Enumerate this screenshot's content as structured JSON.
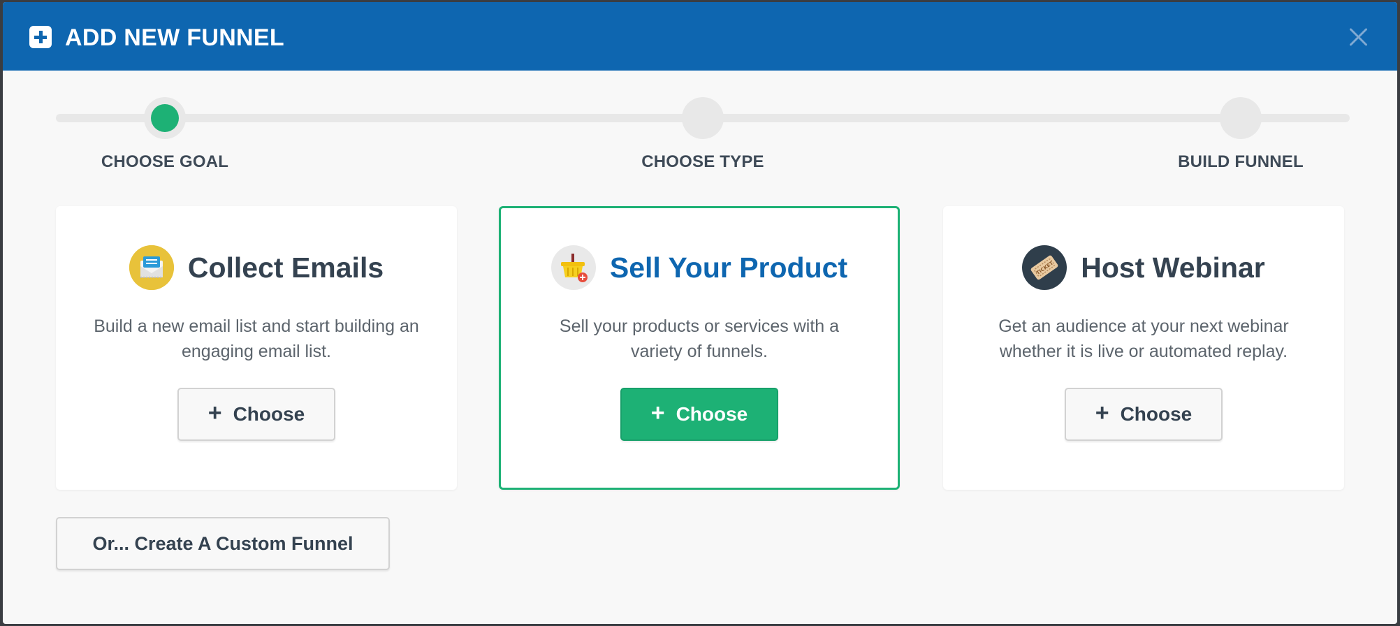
{
  "header": {
    "title": "ADD NEW FUNNEL",
    "icon": "plus-square-icon",
    "close_icon": "close-icon",
    "background": "#0e66b0"
  },
  "stepper": {
    "steps": [
      {
        "label": "CHOOSE GOAL",
        "active": true
      },
      {
        "label": "CHOOSE TYPE",
        "active": false
      },
      {
        "label": "BUILD FUNNEL",
        "active": false
      }
    ],
    "active_color": "#1db175"
  },
  "cards": [
    {
      "title": "Collect Emails",
      "icon": "email-envelope-icon",
      "description": "Build a new email list and start building an engaging email list.",
      "button_label": "Choose",
      "selected": false
    },
    {
      "title": "Sell Your Product",
      "icon": "shopping-basket-icon",
      "description": "Sell your products or services with a variety of funnels.",
      "button_label": "Choose",
      "selected": true
    },
    {
      "title": "Host Webinar",
      "icon": "ticket-icon",
      "description": "Get an audience at your next webinar whether it is live or automated replay.",
      "button_label": "Choose",
      "selected": false
    }
  ],
  "custom_button": {
    "label": "Or... Create A Custom Funnel"
  }
}
